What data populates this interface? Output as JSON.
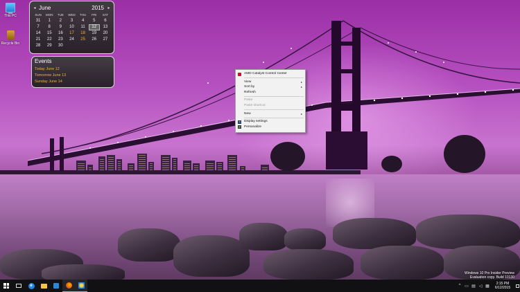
{
  "desktop": {
    "icons": [
      {
        "label": "This PC",
        "icon": "this-pc-icon"
      },
      {
        "label": "Recycle Bin",
        "icon": "recycle-bin-icon"
      }
    ]
  },
  "calendar": {
    "month": "June",
    "year": "2015",
    "prev_icon": "◂",
    "next_icon": "▸",
    "weekdays": [
      "SUN",
      "MON",
      "TUE",
      "WED",
      "THU",
      "FRI",
      "SAT"
    ],
    "weeks": [
      [
        "31",
        "1",
        "2",
        "3",
        "4",
        "5",
        "6"
      ],
      [
        "7",
        "8",
        "9",
        "10",
        "11",
        "12",
        "13"
      ],
      [
        "14",
        "15",
        "16",
        "17",
        "18",
        "19",
        "20"
      ],
      [
        "21",
        "22",
        "23",
        "24",
        "25",
        "26",
        "27"
      ],
      [
        "28",
        "29",
        "30",
        "",
        "",
        "",
        ""
      ]
    ],
    "today": "12",
    "highlighted_days": [
      "17",
      "18",
      "25"
    ],
    "highlight_color": "#f3b233"
  },
  "events": {
    "title": "Events",
    "items": [
      "Today June 12",
      "Tomorrow June 13",
      "Sunday June 14"
    ]
  },
  "context_menu": {
    "items": [
      {
        "label": "AMD Catalyst Control Center",
        "icon": "amd-icon",
        "submenu": false,
        "disabled": false
      },
      {
        "separator": true
      },
      {
        "label": "View",
        "submenu": true,
        "disabled": false
      },
      {
        "label": "Sort by",
        "submenu": true,
        "disabled": false
      },
      {
        "label": "Refresh",
        "submenu": false,
        "disabled": false
      },
      {
        "separator": true
      },
      {
        "label": "Paste",
        "submenu": false,
        "disabled": true
      },
      {
        "label": "Paste shortcut",
        "submenu": false,
        "disabled": true
      },
      {
        "separator": true
      },
      {
        "label": "New",
        "submenu": true,
        "disabled": false
      },
      {
        "separator": true
      },
      {
        "label": "Display settings",
        "icon": "display-settings-icon",
        "submenu": false,
        "disabled": false
      },
      {
        "label": "Personalize",
        "icon": "personalize-icon",
        "submenu": false,
        "disabled": false
      }
    ],
    "submenu_arrow": "▸"
  },
  "watermark": {
    "line1": "Windows 10 Pro Insider Preview",
    "line2": "Evaluation copy. Build 10130"
  },
  "taskbar": {
    "apps": [
      {
        "name": "start",
        "icon": "windows-start-icon"
      },
      {
        "name": "task-view",
        "icon": "task-view-icon"
      },
      {
        "name": "edge",
        "icon": "internet-explorer-icon",
        "glyph": "e"
      },
      {
        "name": "file-explorer",
        "icon": "folder-icon"
      },
      {
        "name": "store",
        "icon": "store-icon"
      },
      {
        "name": "firefox",
        "icon": "firefox-icon"
      },
      {
        "name": "gadgets",
        "icon": "gadgets-icon"
      }
    ],
    "tray_icons": [
      {
        "icon": "chevron-up-icon",
        "glyph": "^"
      },
      {
        "icon": "battery-icon",
        "glyph": "▭"
      },
      {
        "icon": "network-icon",
        "glyph": "▤"
      },
      {
        "icon": "volume-icon",
        "glyph": "◁"
      },
      {
        "icon": "keyboard-icon",
        "glyph": "▦"
      }
    ],
    "time": "2:15 PM",
    "date": "6/12/2015"
  }
}
